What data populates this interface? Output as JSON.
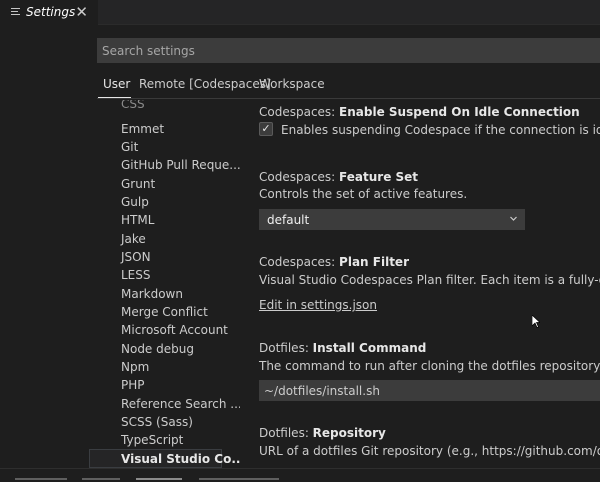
{
  "editor_tab": {
    "label": "Settings",
    "close_glyph": "✕",
    "icon": "menu-icon"
  },
  "search": {
    "placeholder": "Search settings",
    "value": ""
  },
  "scope_tabs": [
    {
      "label": "User",
      "active": true
    },
    {
      "label": "Remote [Codespaces]",
      "active": false
    },
    {
      "label": "Workspace",
      "active": false
    }
  ],
  "toc": {
    "items": [
      "CSS",
      "Emmet",
      "Git",
      "GitHub Pull Reque...",
      "Grunt",
      "Gulp",
      "HTML",
      "Jake",
      "JSON",
      "LESS",
      "Markdown",
      "Merge Conflict",
      "Microsoft Account",
      "Node debug",
      "Npm",
      "PHP",
      "Reference Search ...",
      "SCSS (Sass)",
      "TypeScript",
      "Visual Studio Co..."
    ],
    "selected_index": 19
  },
  "settings": {
    "suspend": {
      "category": "Codespaces: ",
      "name": "Enable Suspend On Idle Connection",
      "checkbox_label": "Enables suspending Codespace if the connection is idle for configu",
      "checked": true
    },
    "feature_set": {
      "category": "Codespaces: ",
      "name": "Feature Set",
      "description": "Controls the set of active features.",
      "selected": "default"
    },
    "plan_filter": {
      "category": "Codespaces: ",
      "name": "Plan Filter",
      "description": "Visual Studio Codespaces Plan filter. Each item is a fully-qualified Plan",
      "link": "Edit in settings.json"
    },
    "install_command": {
      "category": "Dotfiles: ",
      "name": "Install Command",
      "description": "The command to run after cloning the dotfiles repository. Defaults to `~/",
      "value": "~/dotfiles/install.sh"
    },
    "repository": {
      "category": "Dotfiles: ",
      "name": "Repository",
      "description": "URL of a dotfiles Git repository (e.g., https://github.com/owner/repositor"
    }
  },
  "colors": {
    "background": "#1e1e1e",
    "sidebar_tabbar": "#252526",
    "input_bg": "#3c3c3c",
    "text": "#cccccc",
    "heading": "#e7e7e7"
  }
}
